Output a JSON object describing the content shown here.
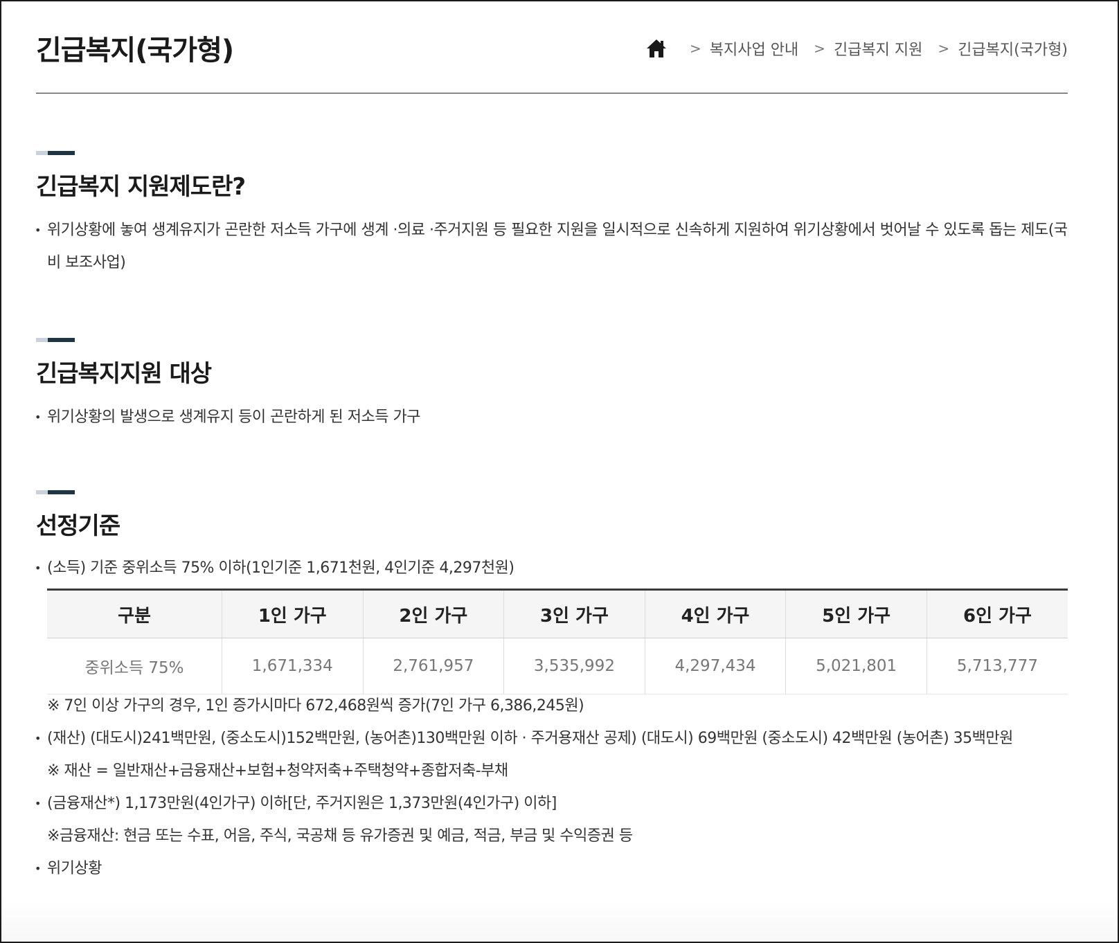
{
  "header": {
    "title": "긴급복지(국가형)",
    "breadcrumb": [
      "복지사업 안내",
      "긴급복지 지원",
      "긴급복지(국가형)"
    ],
    "breadcrumb_sep": ">"
  },
  "sections": {
    "definition": {
      "title": "긴급복지 지원제도란?",
      "text": "위기상황에 놓여 생계유지가 곤란한 저소득 가구에 생계 ·의료 ·주거지원 등 필요한 지원을 일시적으로 신속하게 지원하여 위기상황에서 벗어날 수 있도록 돕는 제도(국비 보조사업)"
    },
    "target": {
      "title": "긴급복지지원 대상",
      "text": "위기상황의 발생으로 생계유지 등이 곤란하게 된 저소득 가구"
    },
    "criteria": {
      "title": "선정기준",
      "income_text": "(소득) 기준 중위소득 75% 이하(1인기준 1,671천원, 4인기준 4,297천원)",
      "table": {
        "headers": [
          "구분",
          "1인 가구",
          "2인 가구",
          "3인 가구",
          "4인 가구",
          "5인 가구",
          "6인 가구"
        ],
        "rows": [
          [
            "중위소득 75%",
            "1,671,334",
            "2,761,957",
            "3,535,992",
            "4,297,434",
            "5,021,801",
            "5,713,777"
          ]
        ]
      },
      "table_note": "※ 7인 이상 가구의 경우, 1인 증가시마다 672,468원씩 증가(7인 가구 6,386,245원)",
      "property_text": "(재산) (대도시)241백만원, (중소도시)152백만원, (농어촌)130백만원 이하 · 주거용재산 공제) (대도시) 69백만원 (중소도시) 42백만원 (농어촌) 35백만원",
      "property_note": "※ 재산 = 일반재산+금융재산+보험+청약저축+주택청약+종합저축-부채",
      "financial_text": "(금융재산*) 1,173만원(4인가구) 이하[단, 주거지원은 1,373만원(4인가구) 이하]",
      "financial_note": "※금융재산: 현금 또는 수표, 어음, 주식, 국공채 등 유가증권 및 예금, 적금, 부금 및 수익증권 등",
      "crisis_text": "위기상황"
    }
  },
  "icons": {
    "home": "home-icon"
  },
  "colors": {
    "section_bar_dark": "#1f3543",
    "section_bar_light": "#c9d2da",
    "table_header_bg": "#f5f5f5"
  }
}
